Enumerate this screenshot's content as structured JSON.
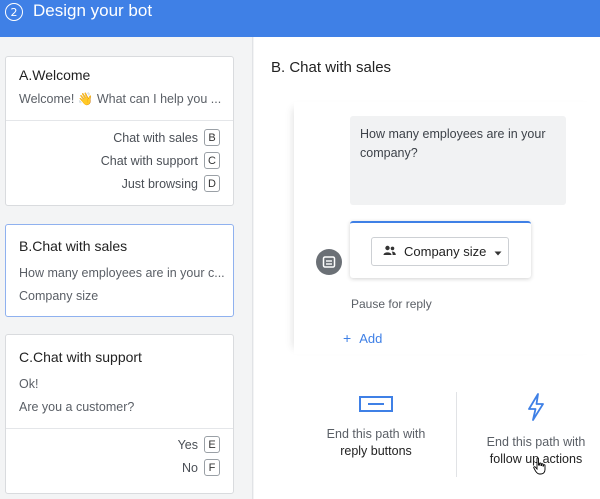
{
  "header": {
    "step": "2",
    "title": "Design your bot"
  },
  "paths": [
    {
      "prefix": "A.",
      "name": "Welcome",
      "texts": [
        "Welcome! 👋 What can I help you ..."
      ],
      "replies": [
        {
          "label": "Chat with sales",
          "key": "B"
        },
        {
          "label": "Chat with support",
          "key": "C"
        },
        {
          "label": "Just browsing",
          "key": "D"
        }
      ]
    },
    {
      "prefix": "B.",
      "name": "Chat with sales",
      "texts": [
        "How many employees are in your c...",
        "Company size"
      ],
      "replies": []
    },
    {
      "prefix": "C.",
      "name": "Chat with support",
      "texts": [
        "Ok!",
        "Are you a customer?"
      ],
      "replies": [
        {
          "label": "Yes",
          "key": "E"
        },
        {
          "label": "No",
          "key": "F"
        }
      ]
    }
  ],
  "editor": {
    "title": "B. Chat with sales",
    "message": "How many employees are in your company?",
    "attribute": "Company size",
    "pause": "Pause for reply",
    "add": "Add"
  },
  "end_options": [
    {
      "line1": "End this path with",
      "line2": "reply buttons",
      "icon": "reply-buttons-icon"
    },
    {
      "line1": "End this path with",
      "line2": "follow up actions",
      "icon": "lightning-icon"
    }
  ],
  "colors": {
    "accent": "#3f80e6",
    "header_bg": "#3f80e6"
  }
}
